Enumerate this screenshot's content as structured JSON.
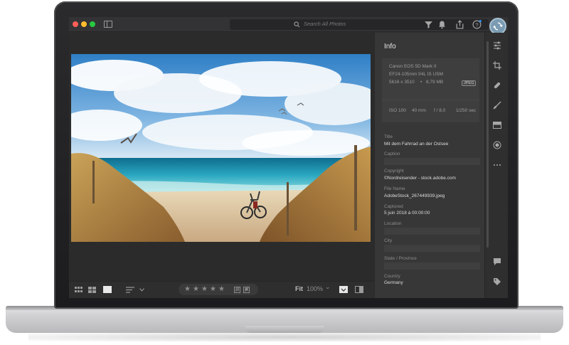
{
  "app": {
    "search_placeholder": "Search All Photos",
    "icons": [
      "filter-icon",
      "bell-icon",
      "share-icon",
      "help-icon",
      "cloud-sync-icon"
    ]
  },
  "toolbar": {
    "fit_label": "Fit",
    "zoom_label": "100%",
    "zoom_caret": "⌄",
    "stars": [
      "★",
      "★",
      "★",
      "★",
      "★"
    ],
    "rating": 0
  },
  "info": {
    "title": "Info",
    "camera": "Canon EOS 5D Mark II",
    "lens": "EF24-105mm f/4L IS USM",
    "dimensions": "5616 x 3510",
    "separator": "•",
    "file_size": "8,79 MB",
    "format": "JPEG",
    "iso": "ISO 100",
    "focal_length": "40 mm",
    "aperture": "f / 8,0",
    "shutter": "1/250 sec",
    "fields": {
      "title_label": "Title",
      "title_value": "Mit dem Fahrrad an der Ostsee",
      "caption_label": "Caption",
      "copyright_label": "Copyright",
      "copyright_value": "©Nordreisender - stock.adobe.com",
      "filename_label": "File Name",
      "filename_value": "AdobeStock_267449939.jpeg",
      "captured_label": "Captured",
      "captured_value": "5 juin 2018 à 00:00:00",
      "location_label": "Location",
      "city_label": "City",
      "state_label": "State / Province",
      "country_label": "Country",
      "country_value": "Germany"
    }
  },
  "right_strip_icons": [
    "edit-sliders-icon",
    "crop-icon",
    "healing-icon",
    "brush-icon",
    "gradient-icon",
    "radial-icon",
    "more-icon",
    "comment-icon",
    "keyword-tag-icon",
    "info-icon"
  ]
}
